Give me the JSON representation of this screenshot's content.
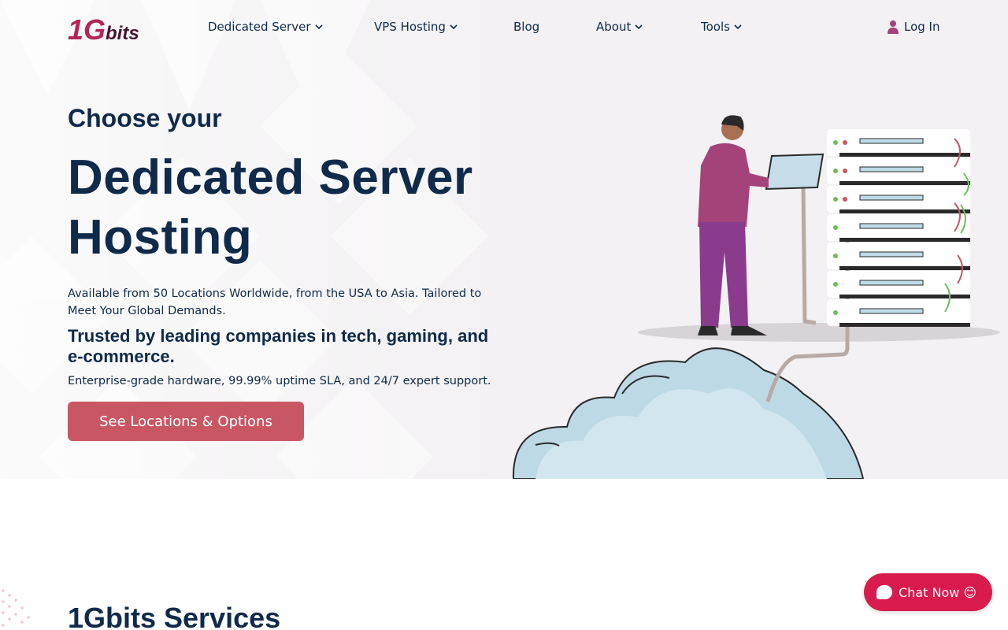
{
  "brand": {
    "logo_main": "1G",
    "logo_suffix": "bits",
    "colors": {
      "primary_text": "#0f2a4a",
      "accent": "#c95763",
      "chat": "#d91a4c",
      "logo": "#b3265a"
    }
  },
  "nav": {
    "items": [
      {
        "label": "Dedicated Server",
        "dropdown": true
      },
      {
        "label": "VPS Hosting",
        "dropdown": true
      },
      {
        "label": "Blog",
        "dropdown": false
      },
      {
        "label": "About",
        "dropdown": true
      },
      {
        "label": "Tools",
        "dropdown": true
      }
    ],
    "login_label": "Log In",
    "login_icon": "user-icon"
  },
  "hero": {
    "pre_title": "Choose your",
    "title_line1": "Dedicated Server",
    "title_line2": "Hosting",
    "description": "Available from 50 Locations Worldwide, from the USA to Asia. Tailored to Meet Your Global Demands.",
    "trusted": "Trusted by leading companies in tech, gaming, and e-commerce.",
    "enterprise": "Enterprise-grade hardware, 99.99% uptime SLA, and 24/7 expert support.",
    "cta_label": "See Locations & Options"
  },
  "services": {
    "title": "1Gbits Services"
  },
  "chat": {
    "label": "Chat Now 😊",
    "icon": "chat-bubble-icon"
  }
}
